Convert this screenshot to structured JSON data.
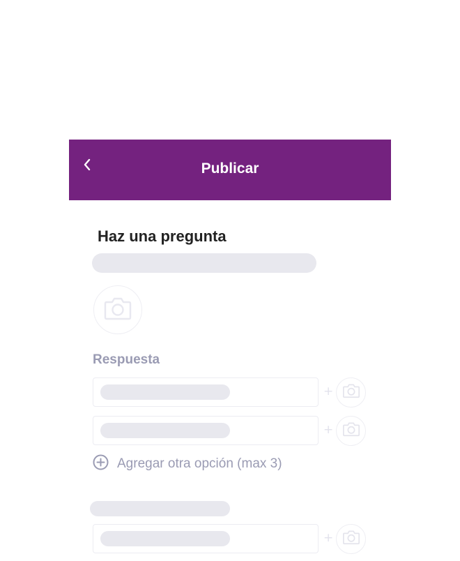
{
  "header": {
    "title": "Publicar",
    "back_icon": "chevron-left-icon",
    "background_color": "#74227f"
  },
  "question": {
    "title": "Haz una pregunta",
    "camera_icon": "camera-icon"
  },
  "answers": {
    "label": "Respuesta",
    "plus_symbol": "+",
    "add_option_label": "Agregar otra opción (max 3)",
    "add_option_icon": "plus-circle-icon"
  }
}
